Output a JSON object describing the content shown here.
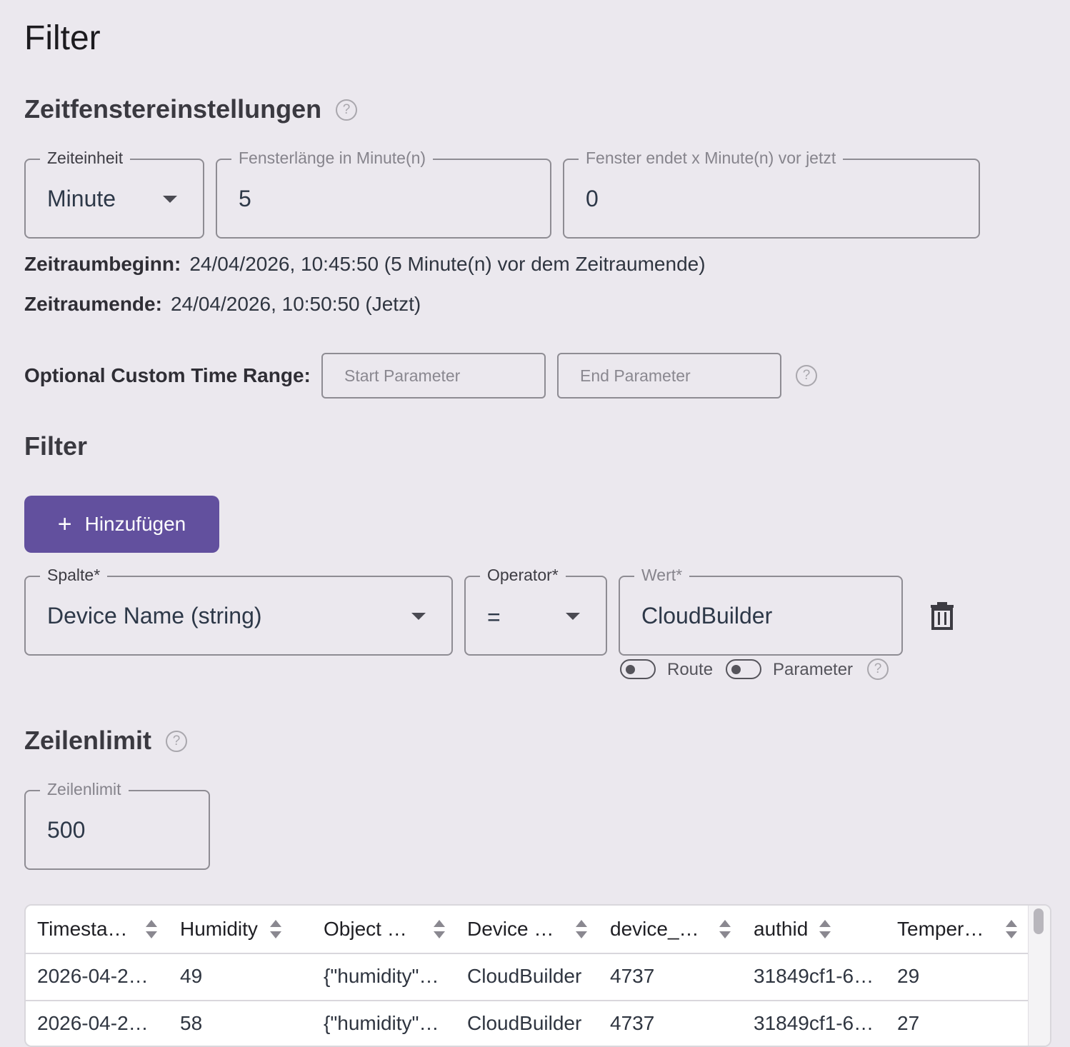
{
  "page": {
    "title": "Filter"
  },
  "time_window": {
    "heading": "Zeitfenstereinstellungen",
    "unit": {
      "label": "Zeiteinheit",
      "value": "Minute"
    },
    "length": {
      "label": "Fensterlänge in Minute(n)",
      "value": "5"
    },
    "offset": {
      "label": "Fenster endet x Minute(n) vor jetzt",
      "value": "0"
    },
    "start": {
      "label": "Zeitraumbeginn:",
      "value": "24/04/2026, 10:45:50 (5 Minute(n) vor dem Zeitraumende)"
    },
    "end": {
      "label": "Zeitraumende:",
      "value": "24/04/2026, 10:50:50 (Jetzt)"
    },
    "custom": {
      "label": "Optional Custom Time Range:",
      "start_placeholder": "Start Parameter",
      "end_placeholder": "End Parameter"
    }
  },
  "filter": {
    "heading": "Filter",
    "add_button": "Hinzufügen",
    "column": {
      "label": "Spalte*",
      "value": "Device Name (string)"
    },
    "operator": {
      "label": "Operator*",
      "value": "="
    },
    "value": {
      "label": "Wert*",
      "value": "CloudBuilder"
    },
    "toggle_route": "Route",
    "toggle_parameter": "Parameter"
  },
  "row_limit": {
    "heading": "Zeilenlimit",
    "label": "Zeilenlimit",
    "value": "500"
  },
  "table": {
    "headers": [
      "Timesta…",
      "Humidity",
      "Object …",
      "Device …",
      "device_…",
      "authid",
      "Temper…"
    ],
    "rows": [
      [
        "2026-04-2…",
        "49",
        "{\"humidity\"…",
        "CloudBuilder",
        "4737",
        "31849cf1-6…",
        "29"
      ],
      [
        "2026-04-2…",
        "58",
        "{\"humidity\"…",
        "CloudBuilder",
        "4737",
        "31849cf1-6…",
        "27"
      ]
    ]
  }
}
